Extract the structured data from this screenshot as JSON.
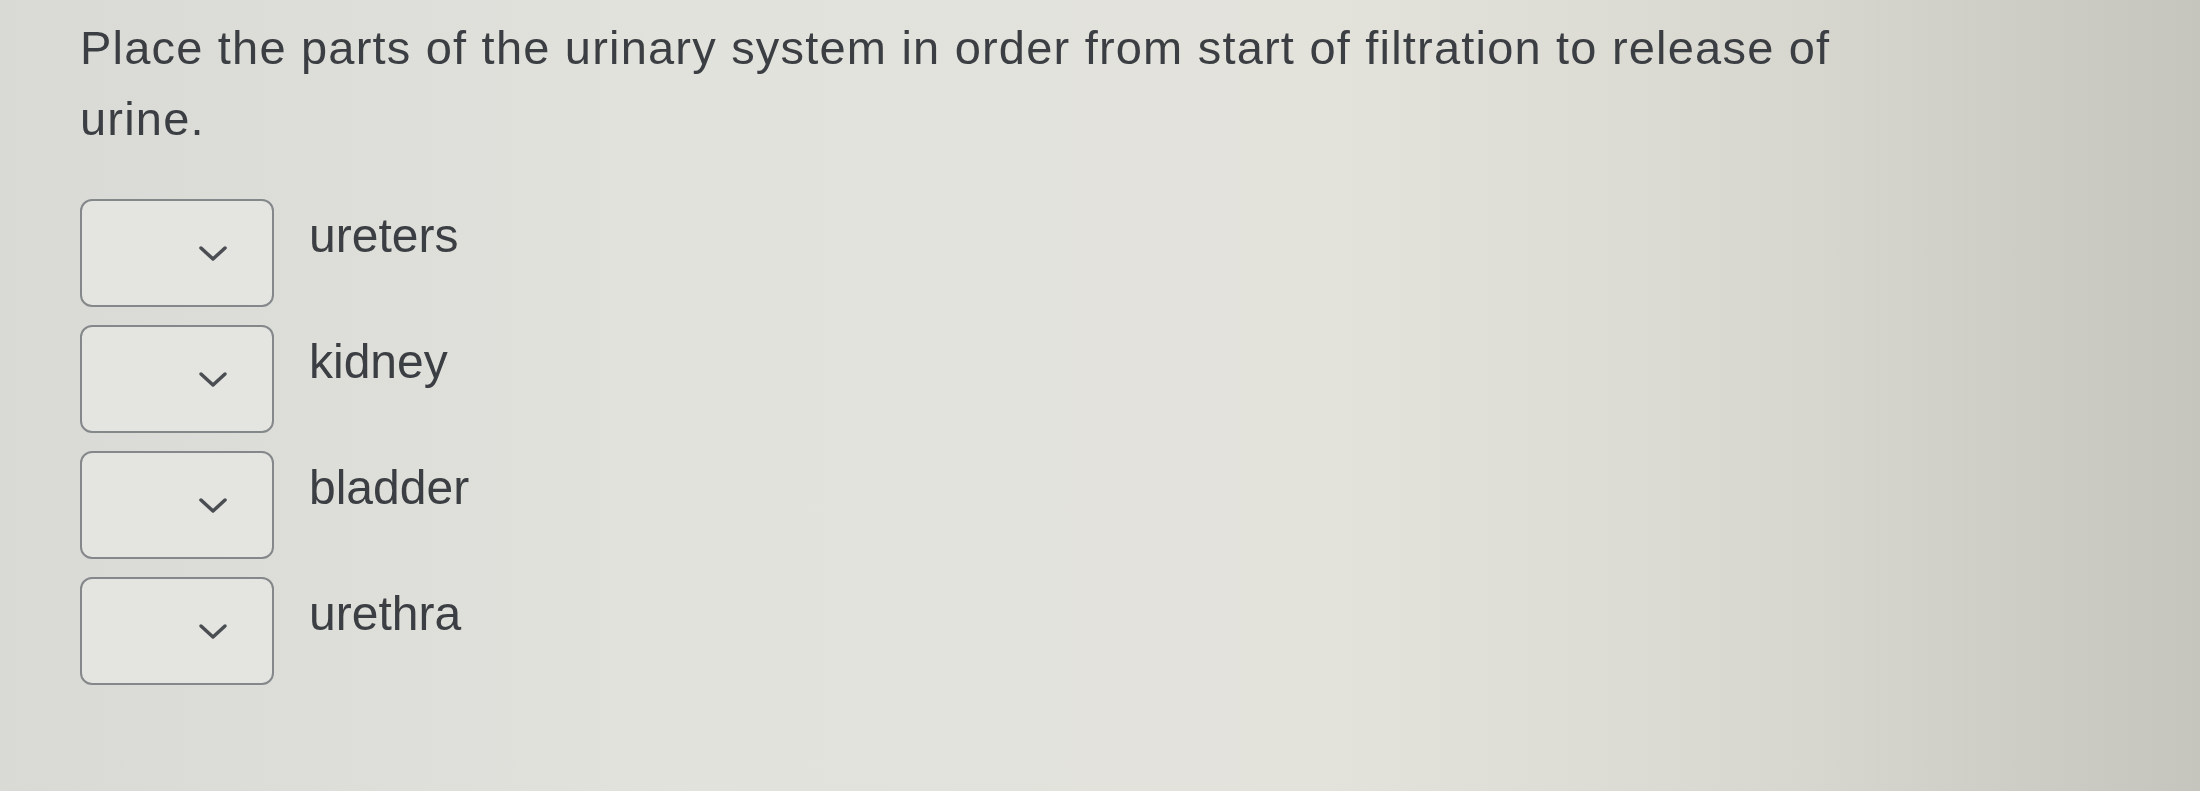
{
  "question": "Place the parts of the urinary system in order from start of filtration to release of urine.",
  "items": [
    {
      "label": "ureters"
    },
    {
      "label": "kidney"
    },
    {
      "label": "bladder"
    },
    {
      "label": "urethra"
    }
  ]
}
